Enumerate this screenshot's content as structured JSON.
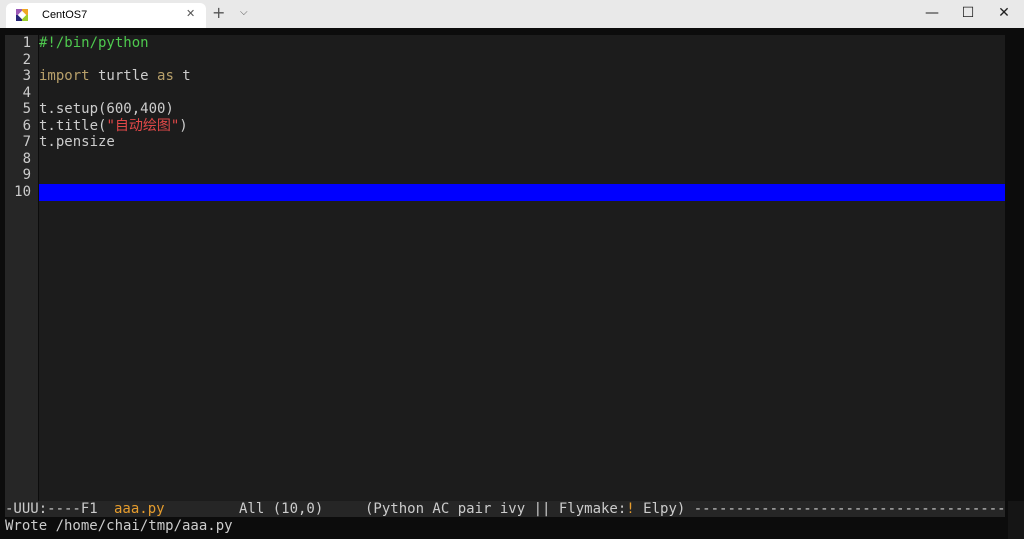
{
  "window": {
    "tab_title": "CentOS7",
    "tab_close": "✕",
    "new_tab": "+",
    "tab_dropdown": "⌵",
    "minimize": "—",
    "maximize": "☐",
    "close": "✕"
  },
  "editor": {
    "lines": [
      {
        "no": "1",
        "segments": [
          {
            "t": "#!/bin/python",
            "c": "comment"
          }
        ]
      },
      {
        "no": "2",
        "segments": []
      },
      {
        "no": "3",
        "segments": [
          {
            "t": "import",
            "c": "kw"
          },
          {
            "t": " turtle ",
            "c": ""
          },
          {
            "t": "as",
            "c": "kw"
          },
          {
            "t": " t",
            "c": ""
          }
        ]
      },
      {
        "no": "4",
        "segments": []
      },
      {
        "no": "5",
        "segments": [
          {
            "t": "t.setup(600,400)",
            "c": ""
          }
        ]
      },
      {
        "no": "6",
        "segments": [
          {
            "t": "t.title(",
            "c": ""
          },
          {
            "t": "\"自动绘图\"",
            "c": "str"
          },
          {
            "t": ")",
            "c": ""
          }
        ]
      },
      {
        "no": "7",
        "segments": [
          {
            "t": "t.pensize",
            "c": ""
          }
        ]
      },
      {
        "no": "8",
        "segments": []
      },
      {
        "no": "9",
        "segments": []
      },
      {
        "no": "10",
        "segments": []
      }
    ],
    "current_line": "10"
  },
  "modeline": {
    "status": "-UUU:----F1",
    "buffer": "aaa.py",
    "position": "All (10,0)",
    "modes_before": "(Python AC pair ivy || Flymake:",
    "flymake_flag": "!",
    "modes_after": " Elpy) -------------------------------------"
  },
  "echo_area": "Wrote /home/chai/tmp/aaa.py",
  "colors": {
    "background": "#0c0c0c",
    "text": "#cccccc",
    "comment": "#4ec94e",
    "keyword": "#b8a06a",
    "string": "#e04848",
    "current_line": "#0000ff",
    "buffer_name": "#e59c2d"
  }
}
